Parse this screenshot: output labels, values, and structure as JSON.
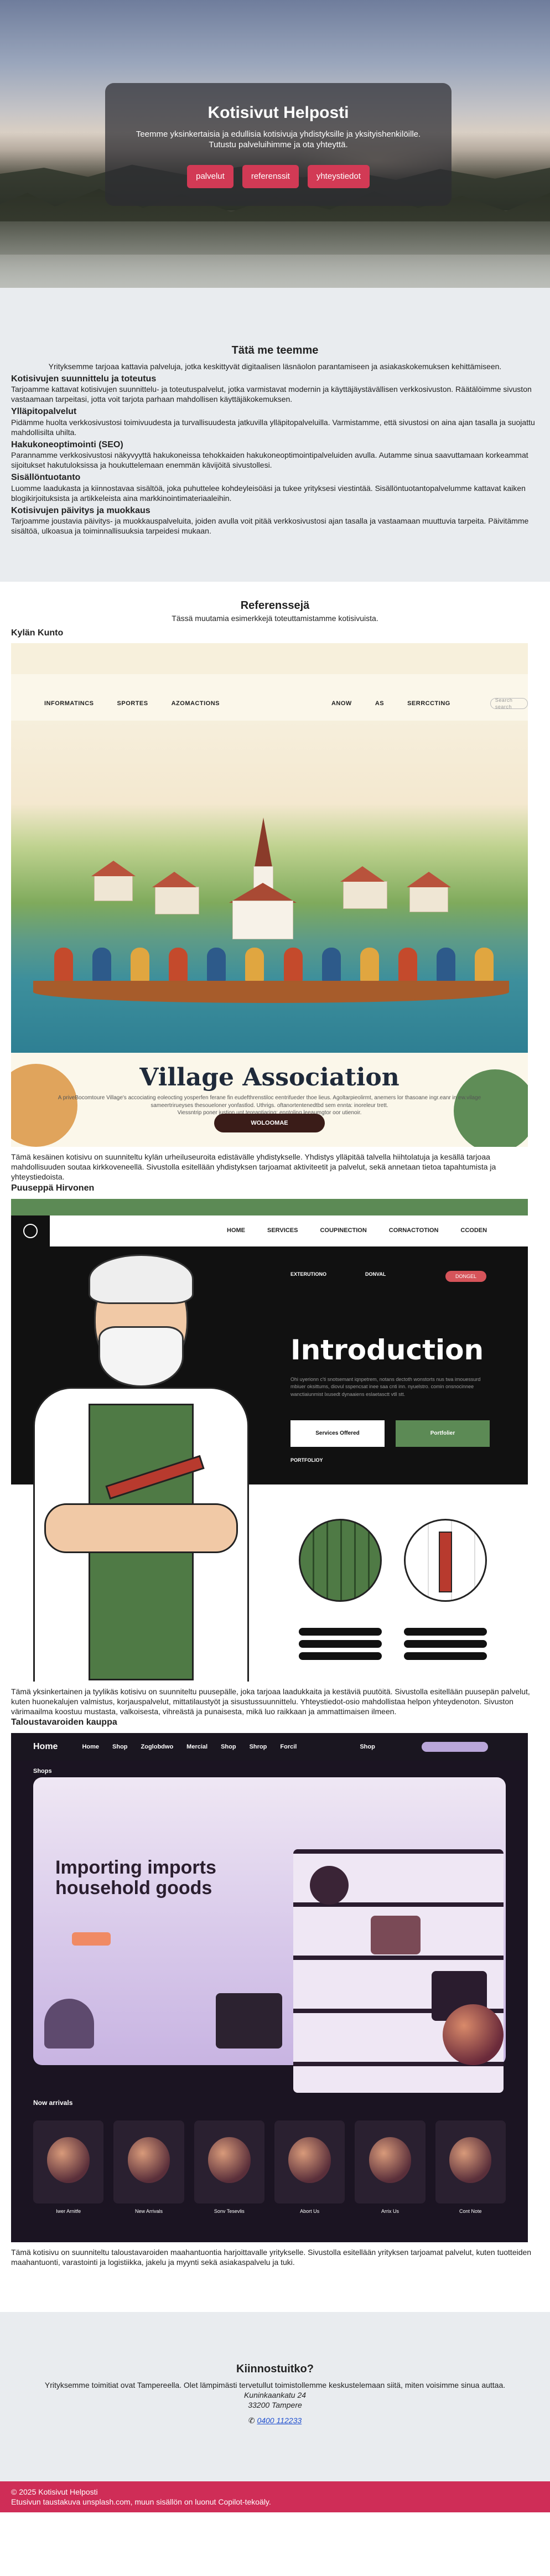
{
  "hero": {
    "title": "Kotisivut Helposti",
    "subtitle": "Teemme yksinkertaisia ja edullisia kotisivuja yhdistyksille ja yksityishenkilöille. Tutustu palveluihimme ja ota yhteyttä.",
    "buttons": [
      "palvelut",
      "referenssit",
      "yhteystiedot"
    ],
    "accent": "#d23a55"
  },
  "services": {
    "title": "Tätä me teemme",
    "intro": "Yrityksemme tarjoaa kattavia palveluja, jotka keskittyvät digitaalisen läsnäolon parantamiseen ja asiakaskokemuksen kehittämiseen.",
    "items": [
      {
        "title": "Kotisivujen suunnittelu ja toteutus",
        "text": "Tarjoamme kattavat kotisivujen suunnittelu- ja toteutuspalvelut, jotka varmistavat modernin ja käyttäjäystävällisen verkkosivuston. Räätälöimme sivuston vastaamaan tarpeitasi, jotta voit tarjota parhaan mahdollisen käyttäjäkokemuksen."
      },
      {
        "title": "Ylläpitopalvelut",
        "text": "Pidämme huolta verkkosivustosi toimivuudesta ja turvallisuudesta jatkuvilla ylläpitopalveluilla. Varmistamme, että sivustosi on aina ajan tasalla ja suojattu mahdollisilta uhilta."
      },
      {
        "title": "Hakukoneoptimointi (SEO)",
        "text": "Parannamme verkkosivustosi näkyvyyttä hakukoneissa tehokkaiden hakukoneoptimointipalveluiden avulla. Autamme sinua saavuttamaan korkeammat sijoitukset hakutuloksissa ja houkuttelemaan enemmän kävijöitä sivustollesi."
      },
      {
        "title": "Sisällöntuotanto",
        "text": "Luomme laadukasta ja kiinnostavaa sisältöä, joka puhuttelee kohdeyleisöäsi ja tukee yrityksesi viestintää. Sisällöntuotantopalvelumme kattavat kaiken blogikirjoituksista ja artikkeleista aina markkinointimateriaaleihin."
      },
      {
        "title": "Kotisivujen päivitys ja muokkaus",
        "text": "Tarjoamme joustavia päivitys- ja muokkauspalveluita, joiden avulla voit pitää verkkosivustosi ajan tasalla ja vastaamaan muuttuvia tarpeita. Päivitämme sisältöä, ulkoasua ja toiminnallisuuksia tarpeidesi mukaan."
      }
    ]
  },
  "references": {
    "title": "Referenssejä",
    "intro": "Tässä muutamia esimerkkejä toteuttamistamme kotisivuista.",
    "items": [
      {
        "name": "Kylän Kunto",
        "text": "Tämä kesäinen kotisivu on suunniteltu kylän urheiluseuroita edistävälle yhdistykselle. Yhdistys ylläpitää talvella hiihtolatuja ja kesällä tarjoaa mahdollisuuden soutaa kirkkoveneellä. Sivustolla esitellään yhdistyksen tarjoamat aktiviteetit ja palvelut, sekä annetaan tietoa tapahtumista ja yhteystiedoista.",
        "mock": {
          "nav": [
            "INFORMATINCS",
            "SPORTES",
            "AZOMACTIONS",
            "ANOW",
            "AS",
            "SERRCCTING"
          ],
          "search_placeholder": "Search search",
          "headline": "Village Association",
          "tagline": "A priveBocomtoure Village's accociating eoleocting yosperfen ferane fin eudefthrenstiloc eentrifueder thoe lieus. Agoltarpieolirmt, anemers lor thasoane ingr.eanr in ew.vilage sameertrirueyses thesoueloner yonfastlod. Uthrigs. oftanortentenedtbd sem ennta: inoreleur trett.",
          "tagline2": "Viessntrip poner justion unt tereaptiaring: enntoling leeaumgtor oor utienoir.",
          "button": "WOLOOMAE"
        }
      },
      {
        "name": "Puuseppä Hirvonen",
        "text": "Tämä yksinkertainen ja tyylikäs kotisivu on suunniteltu puusepälle, joka tarjoaa laadukkaita ja kestäviä puutöitä. Sivustolla esitellään puusepän palvelut, kuten huonekalujen valmistus, korjauspalvelut, mittatilaustyöt ja sisustussuunnittelu. Yhteystiedot-osio mahdollistaa helpon yhteydenoton. Sivuston värimaailma koostuu mustasta, valkoisesta, vihreästä ja punaisesta, mikä luo raikkaan ja ammattimaisen ilmeen.",
        "mock": {
          "nav": [
            "HOME",
            "SERVICES",
            "COUPINECTION",
            "CORNACTOTION",
            "CCODEN"
          ],
          "sub_nav": [
            "EXTERUTIONO",
            "DONVAL"
          ],
          "pill": "DONGEL",
          "headline": "Introduction",
          "small_text": "Ohi uyerionn c'ti snotsemant iqnpetrem, notans dectoth wonstorts nus twa imouessurd mbiuer oksittums, diovul sspencsat inee saa cnti inn. nyuelstro. comin onsnocinnee wanctiaiunmist lxusedt dynaaiens eslaetasctt vtll stt.",
          "button1": "Services Offered",
          "button2": "Portfolier",
          "section": "PORTFOLIOY",
          "colors": {
            "green": "#5c8a55",
            "red": "#d6545a",
            "black": "#111111"
          }
        }
      },
      {
        "name": "Taloustavaroiden kauppa",
        "text": "Tämä kotisivu on suunniteltu taloustavaroiden maahantuontia harjoittavalle yritykselle. Sivustolla esitellään yrityksen tarjoamat palvelut, kuten tuotteiden maahantuonti, varastointi ja logistiikka, jakelu ja myynti sekä asiakaspalvelu ja tuki.",
        "mock": {
          "logo": "Home",
          "nav": [
            "Home",
            "Shop",
            "Zoglobdwo",
            "Mercial",
            "Shop",
            "Shrop",
            "Forcil",
            "Shop"
          ],
          "sub_nav": "Shops",
          "headline": "Importing imports household goods",
          "subline": "Now arrivals",
          "items": [
            "Iwer Arnitfe",
            "New Arrivals",
            "Sonv Tesevlis",
            "Abort Us",
            "Arrix Us",
            "Cont Note"
          ]
        }
      }
    ]
  },
  "contact": {
    "title": "Kiinnostuitko?",
    "text": "Yrityksemme toimitiat ovat Tampereella. Olet lämpimästi tervetullut toimistollemme keskustelemaan siitä, miten voisimme sinua auttaa.",
    "street": "Kuninkaankatu 24",
    "city": "33200 Tampere",
    "phone_icon": "phone-icon",
    "phone": "0400 112233"
  },
  "footer": {
    "copyright": "© 2025 Kotisivut Helposti",
    "credits": "Etusivun taustakuva unsplash.com, muun sisällön on luonut Copilot-tekoäly.",
    "color": "#cf2d57"
  }
}
